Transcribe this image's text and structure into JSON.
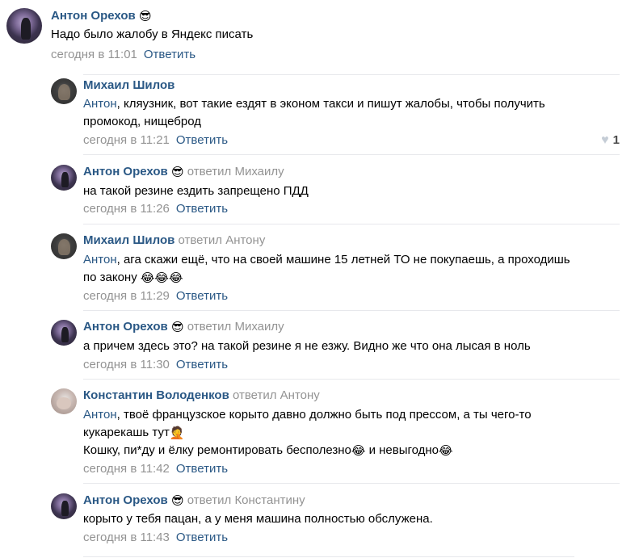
{
  "comments": [
    {
      "author": "Антон Орехов",
      "emoji": "😎",
      "reply_to": "",
      "mention": "",
      "text": "Надо было жалобу в Яндекс писать",
      "date": "сегодня в 11:01",
      "reply_label": "Ответить"
    },
    {
      "author": "Михаил Шилов",
      "emoji": "",
      "reply_to": "",
      "mention": "Антон",
      "text_line1": ", кляузник, вот такие ездят в эконом такси и пишут жалобы, чтобы получить",
      "text_line2": "промокод, нищеброд",
      "date": "сегодня в 11:21",
      "reply_label": "Ответить",
      "likes": "1"
    },
    {
      "author": "Антон Орехов",
      "emoji": "😎",
      "reply_to": "ответил Михаилу",
      "text": "на такой резине ездить запрещено ПДД",
      "date": "сегодня в 11:26",
      "reply_label": "Ответить"
    },
    {
      "author": "Михаил Шилов",
      "reply_to": "ответил Антону",
      "mention": "Антон",
      "text_line1": ", ага скажи ещё, что на своей машине 15 летней ТО не покупаешь, а проходишь",
      "text_line2": "по закону",
      "text_line2_emoji": "😂😂😂",
      "date": "сегодня в 11:29",
      "reply_label": "Ответить"
    },
    {
      "author": "Антон Орехов",
      "emoji": "😎",
      "reply_to": "ответил Михаилу",
      "text": "а причем здесь это? на такой резине я не езжу. Видно же что она лысая в ноль",
      "date": "сегодня в 11:30",
      "reply_label": "Ответить"
    },
    {
      "author": "Константин Володенков",
      "reply_to": "ответил Антону",
      "mention": "Антон",
      "text_line1": ", твоё французское корыто давно должно быть под прессом, а ты чего-то",
      "text_line2": "кукарекашь тут",
      "text_line2_emoji": "🤦",
      "text_line3a": "Кошку, пи*ду и ёлку ремонтировать бесполезно",
      "text_line3_emoji1": "😂",
      "text_line3b": " и невыгодно",
      "text_line3_emoji2": "😂",
      "date": "сегодня в 11:42",
      "reply_label": "Ответить"
    },
    {
      "author": "Антон Орехов",
      "emoji": "😎",
      "reply_to": "ответил Константину",
      "text": "корыто у тебя пацан, а у меня машина полностью обслужена.",
      "date": "сегодня в 11:43",
      "reply_label": "Ответить"
    }
  ]
}
